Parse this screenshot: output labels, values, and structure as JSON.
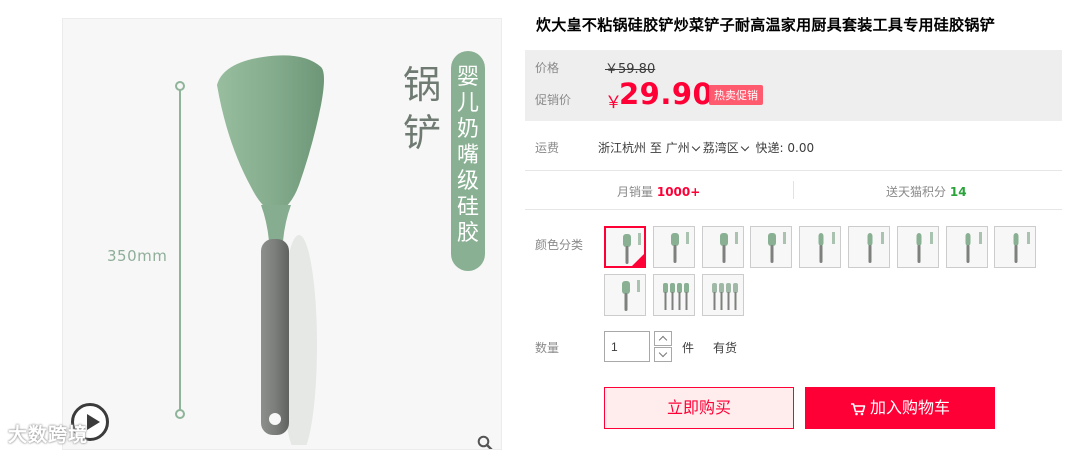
{
  "product": {
    "title": "炊大皇不粘锅硅胶铲炒菜铲子耐高温家用厨具套装工具专用硅胶锅铲"
  },
  "gallery": {
    "dimension_label": "350mm",
    "main_text": "锅铲",
    "badge_text": "婴儿奶嘴级硅胶",
    "watermark": "大数跨境",
    "icons": {
      "play": "play-icon",
      "zoom": "zoom-icon"
    }
  },
  "price": {
    "orig_label": "价格",
    "orig_value": "￥59.80",
    "promo_label": "促销价",
    "currency": "￥",
    "promo_value": "29.90",
    "promo_badge": "热卖促销"
  },
  "shipping": {
    "label": "运费",
    "from": "浙江杭州",
    "to_word": "至",
    "city": "广州",
    "district": "荔湾区",
    "express": "快递: 0.00"
  },
  "stats": {
    "monthly_sales_label": "月销量",
    "monthly_sales_value": "1000+",
    "points_label": "送天猫积分",
    "points_value": "14"
  },
  "colors": {
    "label": "颜色分类",
    "selected_index": 0,
    "option_count": 12
  },
  "quantity": {
    "label": "数量",
    "value": "1",
    "unit": "件",
    "stock": "有货"
  },
  "actions": {
    "buy_now": "立即购买",
    "add_to_cart": "加入购物车"
  },
  "theme": {
    "accent": "#ff0036",
    "silicone_green": "#8ab093",
    "handle_gray": "#7d807d"
  }
}
